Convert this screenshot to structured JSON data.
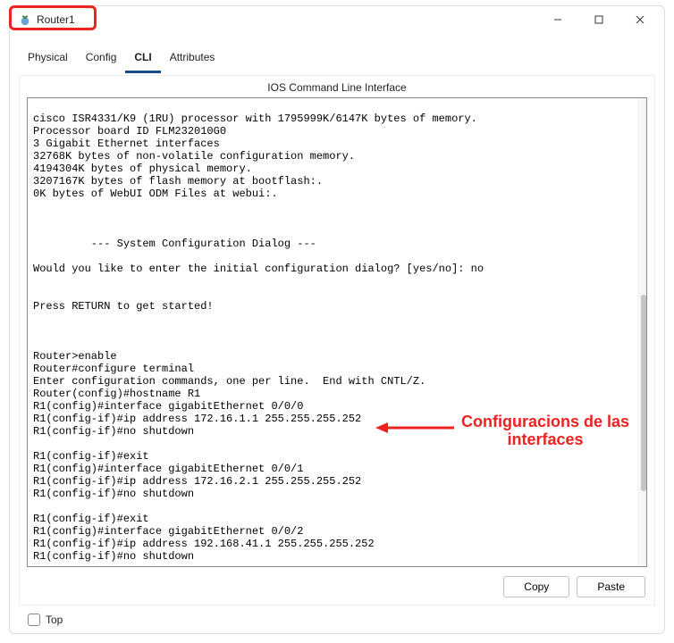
{
  "window": {
    "title": "Router1"
  },
  "tabs": [
    "Physical",
    "Config",
    "CLI",
    "Attributes"
  ],
  "active_tab": 2,
  "panel_title": "IOS Command Line Interface",
  "cli_text": "cisco ISR4331/K9 (1RU) processor with 1795999K/6147K bytes of memory.\nProcessor board ID FLM232010G0\n3 Gigabit Ethernet interfaces\n32768K bytes of non-volatile configuration memory.\n4194304K bytes of physical memory.\n3207167K bytes of flash memory at bootflash:.\n0K bytes of WebUI ODM Files at webui:.\n\n\n\n         --- System Configuration Dialog ---\n\nWould you like to enter the initial configuration dialog? [yes/no]: no\n\n\nPress RETURN to get started!\n\n\n\nRouter>enable\nRouter#configure terminal\nEnter configuration commands, one per line.  End with CNTL/Z.\nRouter(config)#hostname R1\nR1(config)#interface gigabitEthernet 0/0/0\nR1(config-if)#ip address 172.16.1.1 255.255.255.252\nR1(config-if)#no shutdown\n\nR1(config-if)#exit\nR1(config)#interface gigabitEthernet 0/0/1\nR1(config-if)#ip address 172.16.2.1 255.255.255.252\nR1(config-if)#no shutdown\n\nR1(config-if)#exit\nR1(config)#interface gigabitEthernet 0/0/2\nR1(config-if)#ip address 192.168.41.1 255.255.255.252\nR1(config-if)#no shutdown",
  "buttons": {
    "copy": "Copy",
    "paste": "Paste"
  },
  "footer": {
    "top_label": "Top"
  },
  "annotation": {
    "text": "Configuracions de las\ninterfaces"
  }
}
